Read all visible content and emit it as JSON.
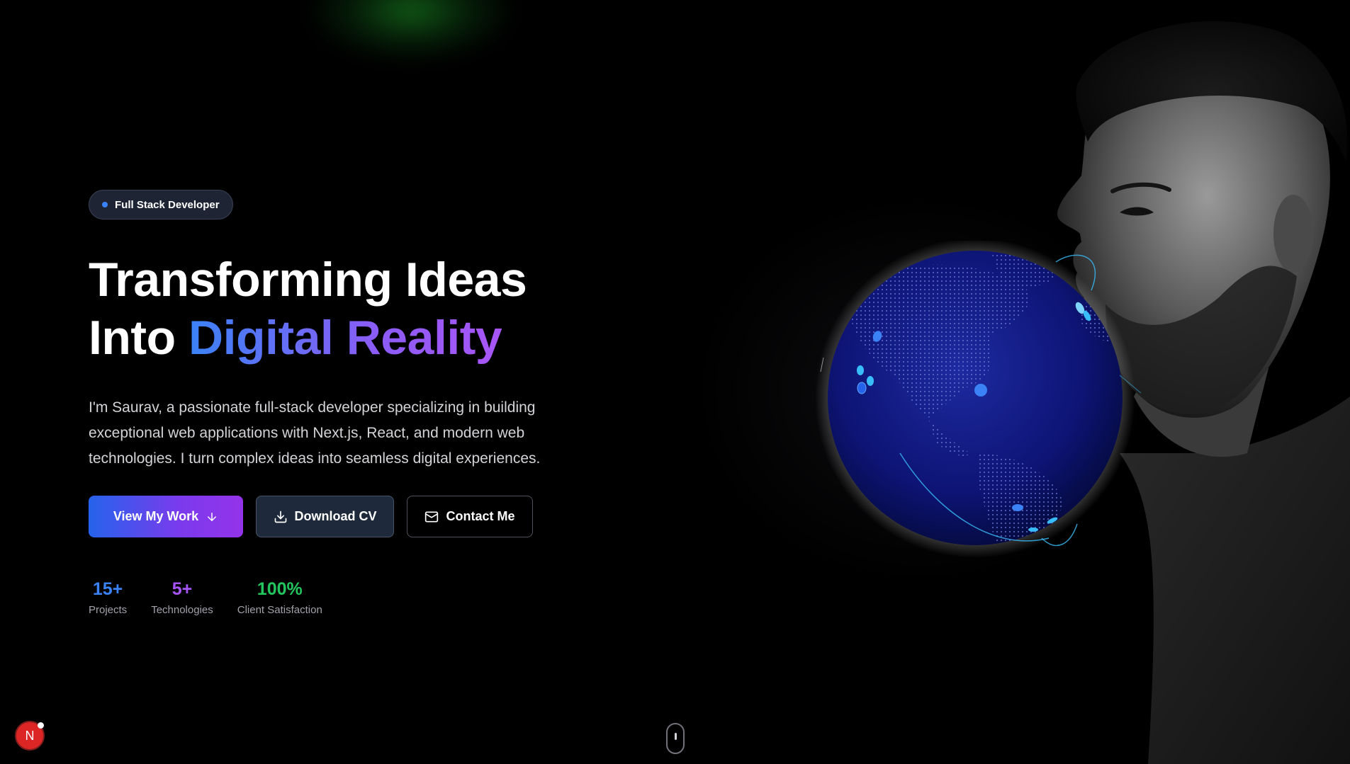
{
  "badge": {
    "label": "Full Stack Developer",
    "dot_color": "#3b82f6"
  },
  "hero": {
    "title_line1": "Transforming Ideas",
    "title_line2_plain": "Into ",
    "title_line2_gradient": "Digital Reality",
    "description": "I'm Saurav, a passionate full-stack developer specializing in building exceptional web applications with Next.js, React, and modern web technologies. I turn complex ideas into seamless digital experiences."
  },
  "buttons": {
    "view_work": {
      "label": "View My Work",
      "icon": "arrow-down-icon"
    },
    "download_cv": {
      "label": "Download CV",
      "icon": "download-icon"
    },
    "contact": {
      "label": "Contact Me",
      "icon": "mail-icon"
    }
  },
  "stats": [
    {
      "value": "15+",
      "label": "Projects",
      "color": "#3b82f6"
    },
    {
      "value": "5+",
      "label": "Technologies",
      "color": "#a855f7"
    },
    {
      "value": "100%",
      "label": "Client Satisfaction",
      "color": "#22c55e"
    }
  ],
  "avatar": {
    "letter": "N",
    "color": "#dc2626"
  },
  "colors": {
    "accent_blue": "#3b82f6",
    "accent_purple": "#8b5cf6",
    "globe_fill": "#0a1166",
    "background": "#000000"
  }
}
